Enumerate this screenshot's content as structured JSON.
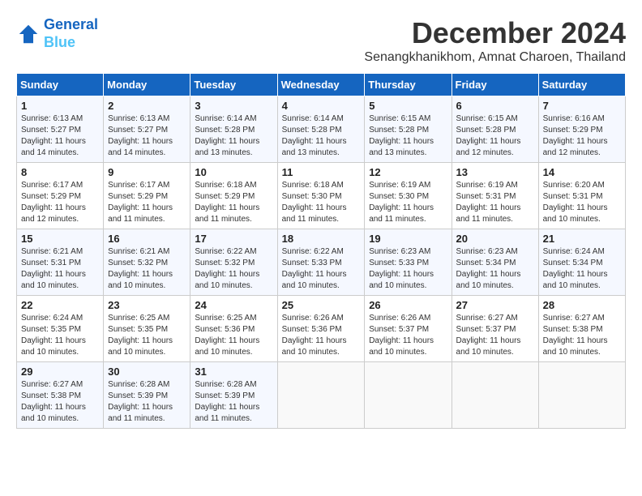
{
  "header": {
    "logo_line1": "General",
    "logo_line2": "Blue",
    "month_title": "December 2024",
    "location": "Senangkhanikhom, Amnat Charoen, Thailand"
  },
  "weekdays": [
    "Sunday",
    "Monday",
    "Tuesday",
    "Wednesday",
    "Thursday",
    "Friday",
    "Saturday"
  ],
  "weeks": [
    [
      {
        "day": "1",
        "sunrise": "6:13 AM",
        "sunset": "5:27 PM",
        "daylight": "11 hours and 14 minutes"
      },
      {
        "day": "2",
        "sunrise": "6:13 AM",
        "sunset": "5:27 PM",
        "daylight": "11 hours and 14 minutes"
      },
      {
        "day": "3",
        "sunrise": "6:14 AM",
        "sunset": "5:28 PM",
        "daylight": "11 hours and 13 minutes"
      },
      {
        "day": "4",
        "sunrise": "6:14 AM",
        "sunset": "5:28 PM",
        "daylight": "11 hours and 13 minutes"
      },
      {
        "day": "5",
        "sunrise": "6:15 AM",
        "sunset": "5:28 PM",
        "daylight": "11 hours and 13 minutes"
      },
      {
        "day": "6",
        "sunrise": "6:15 AM",
        "sunset": "5:28 PM",
        "daylight": "11 hours and 12 minutes"
      },
      {
        "day": "7",
        "sunrise": "6:16 AM",
        "sunset": "5:29 PM",
        "daylight": "11 hours and 12 minutes"
      }
    ],
    [
      {
        "day": "8",
        "sunrise": "6:17 AM",
        "sunset": "5:29 PM",
        "daylight": "11 hours and 12 minutes"
      },
      {
        "day": "9",
        "sunrise": "6:17 AM",
        "sunset": "5:29 PM",
        "daylight": "11 hours and 11 minutes"
      },
      {
        "day": "10",
        "sunrise": "6:18 AM",
        "sunset": "5:29 PM",
        "daylight": "11 hours and 11 minutes"
      },
      {
        "day": "11",
        "sunrise": "6:18 AM",
        "sunset": "5:30 PM",
        "daylight": "11 hours and 11 minutes"
      },
      {
        "day": "12",
        "sunrise": "6:19 AM",
        "sunset": "5:30 PM",
        "daylight": "11 hours and 11 minutes"
      },
      {
        "day": "13",
        "sunrise": "6:19 AM",
        "sunset": "5:31 PM",
        "daylight": "11 hours and 11 minutes"
      },
      {
        "day": "14",
        "sunrise": "6:20 AM",
        "sunset": "5:31 PM",
        "daylight": "11 hours and 10 minutes"
      }
    ],
    [
      {
        "day": "15",
        "sunrise": "6:21 AM",
        "sunset": "5:31 PM",
        "daylight": "11 hours and 10 minutes"
      },
      {
        "day": "16",
        "sunrise": "6:21 AM",
        "sunset": "5:32 PM",
        "daylight": "11 hours and 10 minutes"
      },
      {
        "day": "17",
        "sunrise": "6:22 AM",
        "sunset": "5:32 PM",
        "daylight": "11 hours and 10 minutes"
      },
      {
        "day": "18",
        "sunrise": "6:22 AM",
        "sunset": "5:33 PM",
        "daylight": "11 hours and 10 minutes"
      },
      {
        "day": "19",
        "sunrise": "6:23 AM",
        "sunset": "5:33 PM",
        "daylight": "11 hours and 10 minutes"
      },
      {
        "day": "20",
        "sunrise": "6:23 AM",
        "sunset": "5:34 PM",
        "daylight": "11 hours and 10 minutes"
      },
      {
        "day": "21",
        "sunrise": "6:24 AM",
        "sunset": "5:34 PM",
        "daylight": "11 hours and 10 minutes"
      }
    ],
    [
      {
        "day": "22",
        "sunrise": "6:24 AM",
        "sunset": "5:35 PM",
        "daylight": "11 hours and 10 minutes"
      },
      {
        "day": "23",
        "sunrise": "6:25 AM",
        "sunset": "5:35 PM",
        "daylight": "11 hours and 10 minutes"
      },
      {
        "day": "24",
        "sunrise": "6:25 AM",
        "sunset": "5:36 PM",
        "daylight": "11 hours and 10 minutes"
      },
      {
        "day": "25",
        "sunrise": "6:26 AM",
        "sunset": "5:36 PM",
        "daylight": "11 hours and 10 minutes"
      },
      {
        "day": "26",
        "sunrise": "6:26 AM",
        "sunset": "5:37 PM",
        "daylight": "11 hours and 10 minutes"
      },
      {
        "day": "27",
        "sunrise": "6:27 AM",
        "sunset": "5:37 PM",
        "daylight": "11 hours and 10 minutes"
      },
      {
        "day": "28",
        "sunrise": "6:27 AM",
        "sunset": "5:38 PM",
        "daylight": "11 hours and 10 minutes"
      }
    ],
    [
      {
        "day": "29",
        "sunrise": "6:27 AM",
        "sunset": "5:38 PM",
        "daylight": "11 hours and 10 minutes"
      },
      {
        "day": "30",
        "sunrise": "6:28 AM",
        "sunset": "5:39 PM",
        "daylight": "11 hours and 11 minutes"
      },
      {
        "day": "31",
        "sunrise": "6:28 AM",
        "sunset": "5:39 PM",
        "daylight": "11 hours and 11 minutes"
      },
      null,
      null,
      null,
      null
    ]
  ]
}
